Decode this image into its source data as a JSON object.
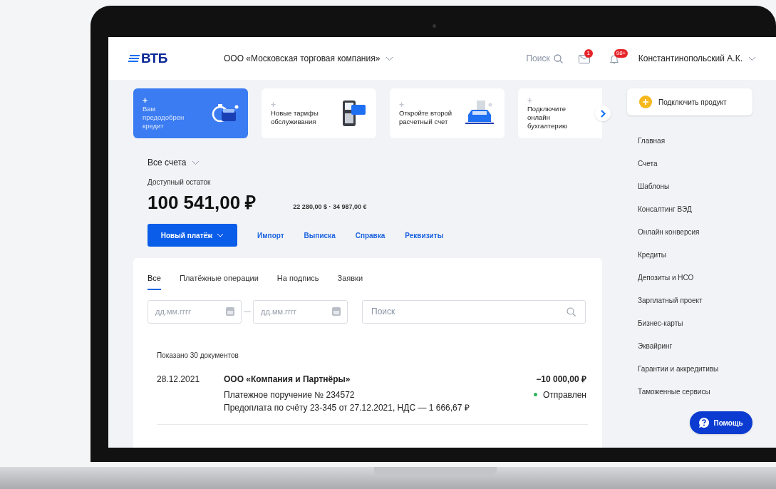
{
  "header": {
    "logo": "ВТБ",
    "company": "ООО «Московская торговая компания»",
    "search": "Поиск",
    "mail_badge": "1",
    "notify_badge": "98+",
    "user": "Константинопольский А.К."
  },
  "promo_cards": [
    {
      "kind": "credit",
      "plus": "+",
      "text": "Вам предодобрен кредит",
      "selected": true
    },
    {
      "kind": "tariff",
      "plus": "+",
      "text": "Новые тарифы обслуживания",
      "selected": false
    },
    {
      "kind": "account",
      "plus": "+",
      "text": "Откройте второй расчетный счет",
      "selected": false
    },
    {
      "kind": "accounting",
      "plus": "+",
      "text": "Подключите онлайн бухгалтерию",
      "selected": false
    }
  ],
  "accounts": {
    "selector": "Все счета",
    "balance_label": "Доступный остаток",
    "balance": "100 541,00 ₽",
    "other_currencies": "22 280,00 $ · 34 987,00 €"
  },
  "actions": {
    "primary": "Новый платёж",
    "links": [
      "Импорт",
      "Выписка",
      "Справка",
      "Реквизиты"
    ]
  },
  "tabs": [
    {
      "label": "Все",
      "selected": true
    },
    {
      "label": "Платёжные операции",
      "selected": false
    },
    {
      "label": "На подпись",
      "selected": false
    },
    {
      "label": "Заявки",
      "selected": false
    }
  ],
  "filters": {
    "date_from": {
      "placeholder": "дд.мм.гггг"
    },
    "date_to": {
      "placeholder": "дд.мм.гггг"
    },
    "search": {
      "placeholder": "Поиск"
    }
  },
  "documents_count": "Показано 30 документов",
  "documents": [
    {
      "date": "28.12.2021",
      "counterparty": "ООО «Компания и Партнёры»",
      "doc": "Платежное поручение № 234572",
      "purpose": "Предоплата по счёту 23-345 от 27.12.2021, НДС — 1 666,67 ₽",
      "amount": "−10 000,00 ₽",
      "status": "Отправлен",
      "color": "#2fb55a"
    }
  ],
  "sidebar": {
    "connect": "Подключить продукт",
    "items": [
      "Главная",
      "Счета",
      "Шаблоны",
      "Консалтинг ВЭД",
      "Онлайн конверсия",
      "Кредиты",
      "Депозиты и НСО",
      "Зарплатный проект",
      "Бизнес-карты",
      "Эквайринг",
      "Гарантии и аккредитивы",
      "Таможенные сервисы"
    ],
    "help": "Помощь"
  }
}
